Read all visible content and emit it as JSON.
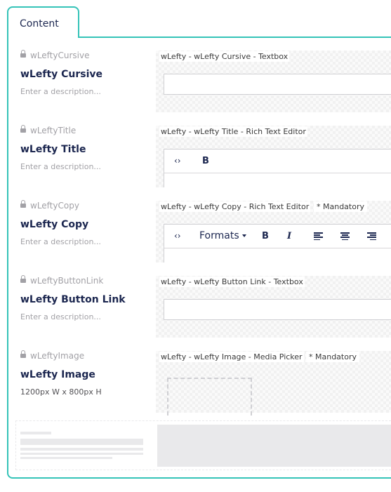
{
  "group": {
    "tab_label": "Content"
  },
  "properties": [
    {
      "alias": "wLeftyCursive",
      "label": "wLefty Cursive",
      "description": "Enter a description...",
      "editor_title": "wLefty - wLefty Cursive - Textbox",
      "mandatory": "",
      "editor": "textbox"
    },
    {
      "alias": "wLeftyTitle",
      "label": "wLefty Title",
      "description": "Enter a description...",
      "editor_title": "wLefty - wLefty Title - Rich Text Editor",
      "mandatory": "",
      "editor": "rte-small",
      "toolbar": {
        "code": "‹›",
        "bold": "B"
      }
    },
    {
      "alias": "wLeftyCopy",
      "label": "wLefty Copy",
      "description": "Enter a description...",
      "editor_title": "wLefty - wLefty Copy - Rich Text Editor",
      "mandatory": "* Mandatory",
      "editor": "rte-full",
      "toolbar": {
        "code": "‹›",
        "formats": "Formats",
        "bold": "B",
        "italic": "I"
      }
    },
    {
      "alias": "wLeftyButtonLink",
      "label": "wLefty Button Link",
      "description": "Enter a description...",
      "editor_title": "wLefty - wLefty Button Link - Textbox",
      "mandatory": "",
      "editor": "textbox"
    },
    {
      "alias": "wLeftyImage",
      "label": "wLefty Image",
      "description": "1200px W x 800px H",
      "editor_title": "wLefty - wLefty Image - Media Picker",
      "mandatory": "* Mandatory",
      "editor": "media-picker"
    }
  ],
  "colors": {
    "accent": "#35c3b8",
    "text": "#1b264f",
    "muted": "#a2a1a6",
    "border": "#cfcfd3"
  },
  "icons": {
    "lock": "lock-icon",
    "code": "code-icon",
    "align_left": "align-left-icon",
    "align_center": "align-center-icon",
    "align_right": "align-right-icon"
  }
}
